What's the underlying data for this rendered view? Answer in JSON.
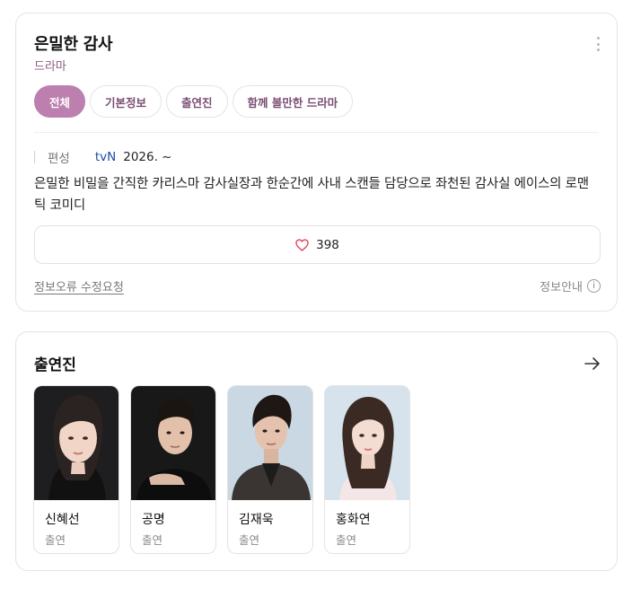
{
  "drama": {
    "title": "은밀한 감사",
    "genre": "드라마",
    "tabs": [
      {
        "label": "전체",
        "active": true
      },
      {
        "label": "기본정보",
        "active": false
      },
      {
        "label": "출연진",
        "active": false
      },
      {
        "label": "함께 볼만한 드라마",
        "active": false
      }
    ],
    "meta": {
      "label": "편성",
      "network": "tvN",
      "date": "2026. ~"
    },
    "description": "은밀한 비밀을 간직한 카리스마 감사실장과 한순간에 사내 스캔들 담당으로 좌천된 감사실 에이스의 로맨틱 코미디",
    "likes": "398",
    "report_link": "정보오류 수정요청",
    "info_guide": "정보안내",
    "info_icon": "i"
  },
  "cast": {
    "title": "출연진",
    "members": [
      {
        "name": "신혜선",
        "role": "출연"
      },
      {
        "name": "공명",
        "role": "출연"
      },
      {
        "name": "김재욱",
        "role": "출연"
      },
      {
        "name": "홍화연",
        "role": "출연"
      }
    ]
  },
  "colors": {
    "accent": "#bd7fae",
    "tab_text": "#7a4d73",
    "network": "#1f4aa3",
    "heart": "#e0405a"
  },
  "icons": [
    "more-vertical-icon",
    "heart-icon",
    "info-icon",
    "arrow-right-icon"
  ]
}
